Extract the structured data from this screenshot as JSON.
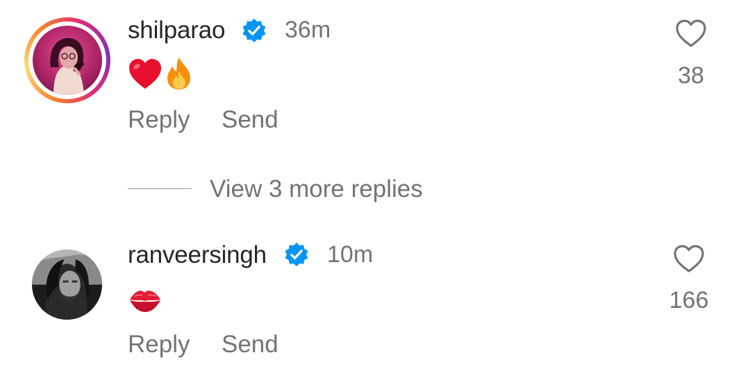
{
  "comments": [
    {
      "username": "shilparao",
      "verified": true,
      "time": "36m",
      "emojis": [
        "heart",
        "fire"
      ],
      "like_count": "38",
      "actions": {
        "reply": "Reply",
        "send": "Send"
      },
      "avatar_story_ring": true
    },
    {
      "username": "ranveersingh",
      "verified": true,
      "time": "10m",
      "emojis": [
        "kiss-mark"
      ],
      "like_count": "166",
      "actions": {
        "reply": "Reply",
        "send": "Send"
      },
      "avatar_story_ring": false
    }
  ],
  "replies_toggle": {
    "label": "View 3 more replies"
  },
  "colors": {
    "text_primary": "#262626",
    "text_secondary": "#737373",
    "verified_blue": "#0095f6",
    "divider": "#c7c7c7"
  }
}
